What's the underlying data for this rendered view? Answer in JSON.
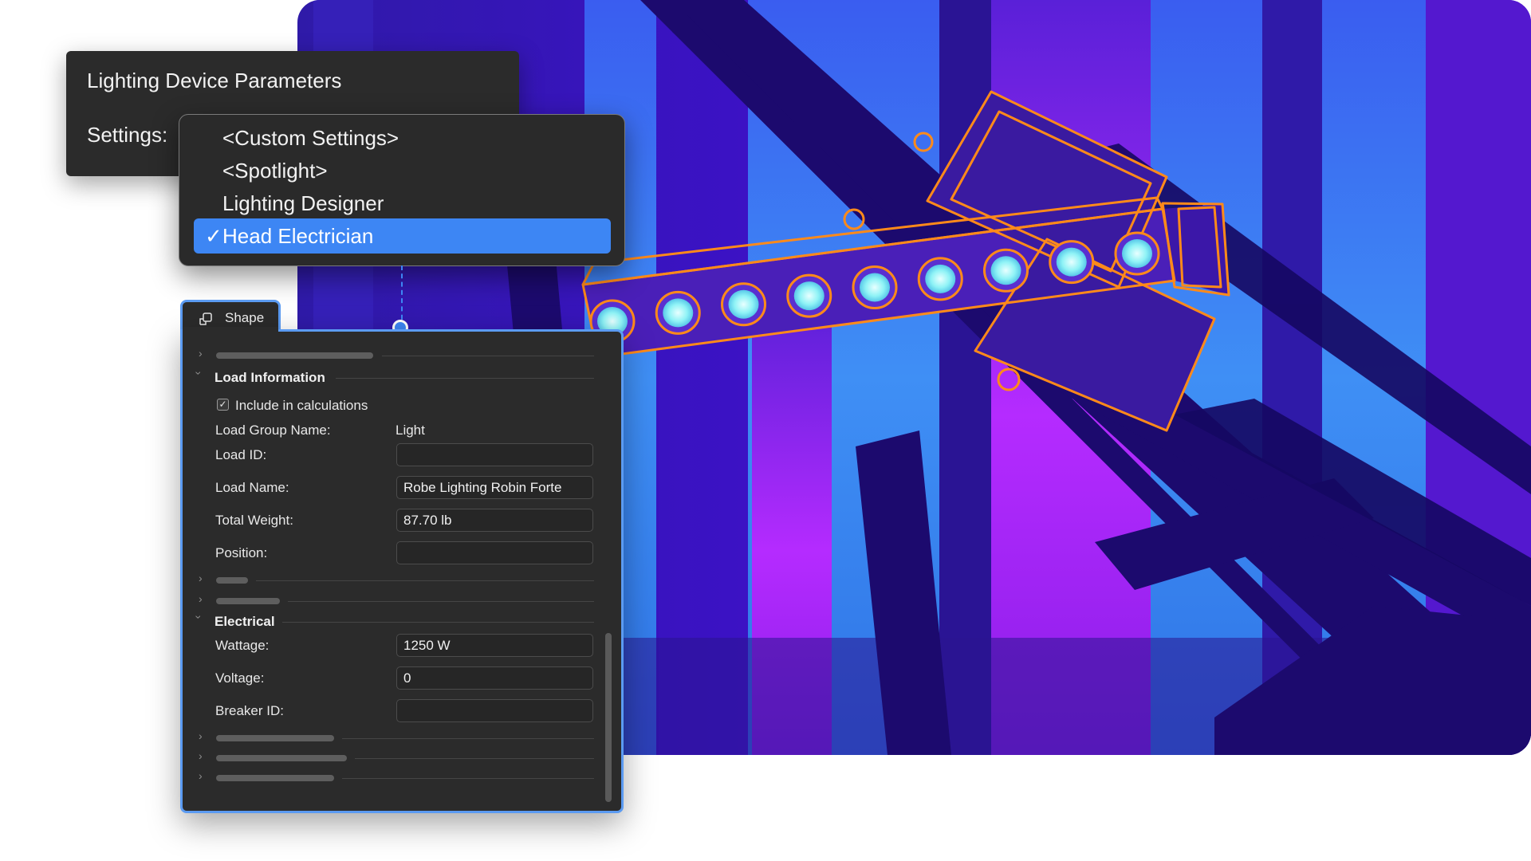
{
  "colors": {
    "accent": "#3d86f4",
    "panel_bg": "#2b2b2b",
    "fixture_outline": "#ff8a1a",
    "scene_purple": "#4a11c9",
    "scene_magenta": "#b52bff",
    "scene_blue": "#2f86f0"
  },
  "lighting_panel": {
    "title": "Lighting Device Parameters",
    "settings_label": "Settings:"
  },
  "settings_dropdown": {
    "options": [
      {
        "label": "<Custom Settings>",
        "selected": false
      },
      {
        "label": "<Spotlight>",
        "selected": false
      },
      {
        "label": "Lighting Designer",
        "selected": false
      },
      {
        "label": "Head Electrician",
        "selected": true
      }
    ],
    "check_mark": "✓"
  },
  "shape_panel": {
    "tab_label": "Shape",
    "tab_icon": "shape-icon",
    "load_information": {
      "title": "Load Information",
      "include_label": "Include in calculations",
      "include_checked": true,
      "load_group_name_label": "Load Group Name:",
      "load_group_name_value": "Light",
      "load_id_label": "Load ID:",
      "load_id_value": "",
      "load_name_label": "Load Name:",
      "load_name_value": "Robe Lighting Robin Forte",
      "total_weight_label": "Total Weight:",
      "total_weight_value": "87.70 lb",
      "position_label": "Position:",
      "position_value": ""
    },
    "electrical": {
      "title": "Electrical",
      "wattage_label": "Wattage:",
      "wattage_value": "1250 W",
      "voltage_label": "Voltage:",
      "voltage_value": "0",
      "breaker_id_label": "Breaker ID:",
      "breaker_id_value": ""
    }
  },
  "scene": {
    "lens_count": 9
  }
}
